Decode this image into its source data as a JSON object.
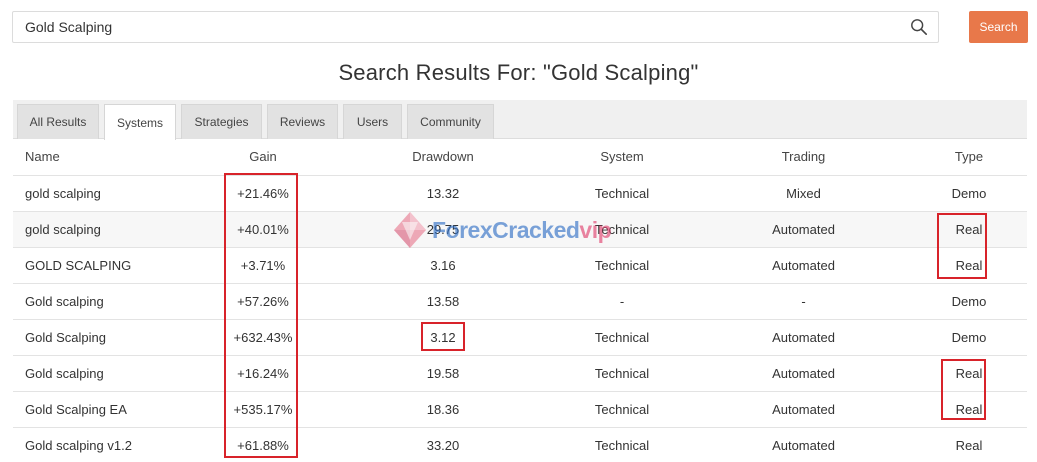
{
  "search": {
    "value": "Gold Scalping",
    "button_label": "Search"
  },
  "page": {
    "title": "Search Results For: \"Gold Scalping\""
  },
  "tabs": [
    {
      "label": "All Results",
      "active": false
    },
    {
      "label": "Systems",
      "active": true
    },
    {
      "label": "Strategies",
      "active": false
    },
    {
      "label": "Reviews",
      "active": false
    },
    {
      "label": "Users",
      "active": false
    },
    {
      "label": "Community",
      "active": false
    }
  ],
  "table": {
    "headers": [
      "Name",
      "Gain",
      "Drawdown",
      "System",
      "Trading",
      "Type"
    ],
    "rows": [
      {
        "name": "gold scalping",
        "gain": "+21.46%",
        "drawdown": "13.32",
        "system": "Technical",
        "trading": "Mixed",
        "type": "Demo"
      },
      {
        "name": "gold scalping",
        "gain": "+40.01%",
        "drawdown": "29.75",
        "system": "Technical",
        "trading": "Automated",
        "type": "Real"
      },
      {
        "name": "GOLD SCALPING",
        "gain": "+3.71%",
        "drawdown": "3.16",
        "system": "Technical",
        "trading": "Automated",
        "type": "Real"
      },
      {
        "name": "Gold scalping",
        "gain": "+57.26%",
        "drawdown": "13.58",
        "system": "-",
        "trading": "-",
        "type": "Demo"
      },
      {
        "name": "Gold Scalping",
        "gain": "+632.43%",
        "drawdown": "3.12",
        "system": "Technical",
        "trading": "Automated",
        "type": "Demo"
      },
      {
        "name": "Gold scalping",
        "gain": "+16.24%",
        "drawdown": "19.58",
        "system": "Technical",
        "trading": "Automated",
        "type": "Real"
      },
      {
        "name": "Gold Scalping EA",
        "gain": "+535.17%",
        "drawdown": "18.36",
        "system": "Technical",
        "trading": "Automated",
        "type": "Real"
      },
      {
        "name": "Gold scalping v1.2",
        "gain": "+61.88%",
        "drawdown": "33.20",
        "system": "Technical",
        "trading": "Automated",
        "type": "Real"
      }
    ]
  },
  "watermark": {
    "part1": "Forex",
    "part2": "Cracked",
    "part3": "vip"
  },
  "colors": {
    "accent": "#e8784a",
    "gain": "#1f9d3a",
    "highlight": "#d8232a"
  },
  "icons": {
    "search": "search-icon",
    "watermark_logo": "diamond-logo-icon"
  }
}
